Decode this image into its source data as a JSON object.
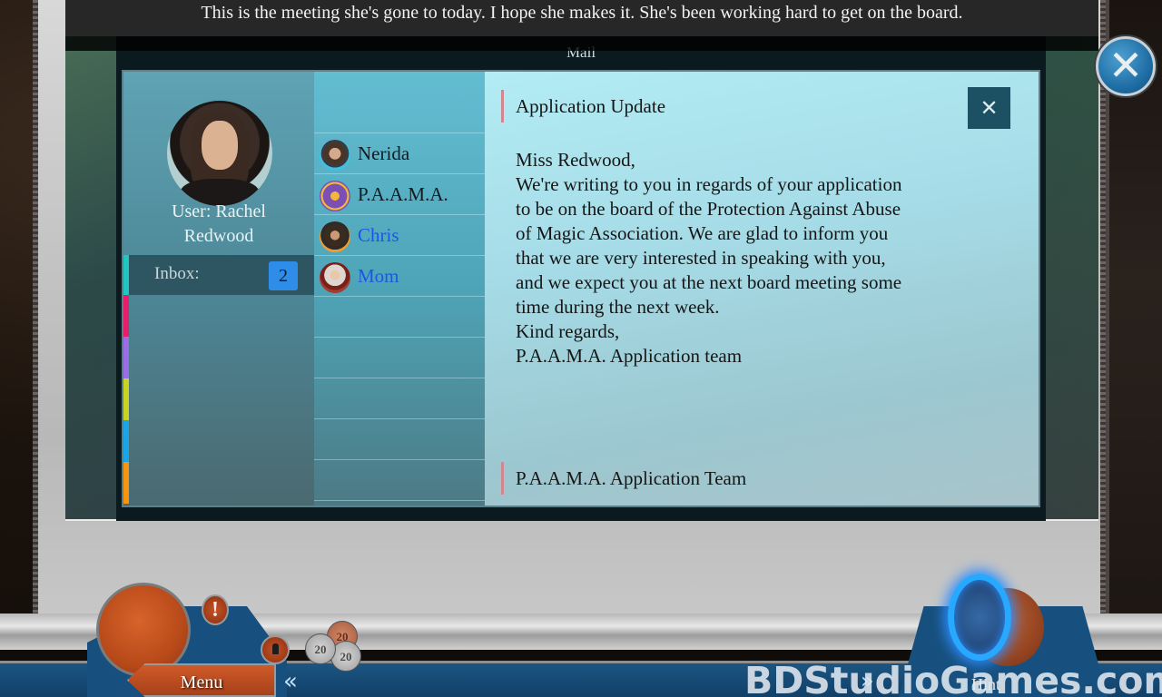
{
  "subtitle": "This is the meeting she's gone to today. I hope she makes it. She's been working hard to get on the board.",
  "mail": {
    "title": "Mail",
    "user_label": "User: Rachel Redwood",
    "user_line1": "User: Rachel",
    "user_line2": "Redwood",
    "inbox_label": "Inbox:",
    "inbox_count": "2",
    "folder_colors": [
      "#e61f6a",
      "#9a6ce6",
      "#c9d323",
      "#1aa6e6",
      "#f7950f"
    ],
    "contacts": [
      {
        "name": "Nerida",
        "color": "#101d22",
        "unread": false,
        "avatar": "nerida-avatar"
      },
      {
        "name": "P.A.A.M.A.",
        "color": "#101d22",
        "unread": false,
        "avatar": "paama-logo"
      },
      {
        "name": "Chris",
        "color": "#1c56e8",
        "unread": true,
        "avatar": "chris-avatar"
      },
      {
        "name": "Mom",
        "color": "#1c56e8",
        "unread": true,
        "avatar": "mom-avatar"
      }
    ],
    "message": {
      "subject": "Application Update",
      "close_icon": "close-x-icon",
      "body_lines": [
        "Miss Redwood,",
        "We're writing to you in regards of your application",
        "to be on the board of the Protection Against Abuse",
        "of Magic Association. We are glad to inform you",
        "that we are very interested in speaking with you,",
        "and we expect you at the next board meeting some",
        "time during the next week.",
        "Kind regards,",
        "P.A.A.M.A. Application team"
      ],
      "sender": "P.A.A.M.A. Application Team"
    }
  },
  "hud": {
    "menu_label": "Menu",
    "hint_label": "Hint",
    "coins": [
      "20",
      "20",
      "20"
    ],
    "alert_glyph": "!",
    "chevron_left": "«",
    "chevron_right": "»",
    "game_close_glyph": "✕"
  },
  "watermark": "BDStudioGames.com"
}
